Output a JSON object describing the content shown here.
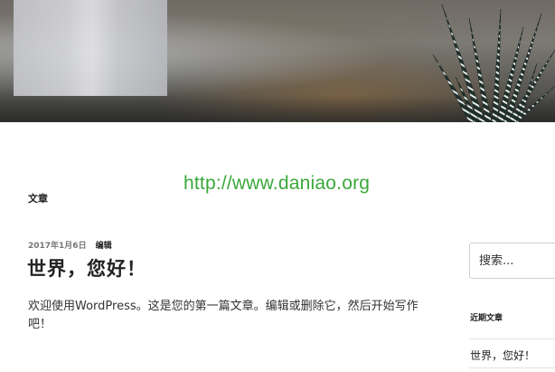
{
  "header": {
    "image_description_icon": "plant-header-image"
  },
  "watermark": {
    "text": "http://www.daniao.org"
  },
  "main": {
    "section_heading": "文章",
    "post": {
      "date": "2017年1月6日",
      "edit_label": "编辑",
      "title": "世界，您好！",
      "excerpt": "欢迎使用WordPress。这是您的第一篇文章。编辑或删除它，然后开始写作吧！"
    }
  },
  "sidebar": {
    "search": {
      "placeholder": "搜索..."
    },
    "recent_posts": {
      "title": "近期文章",
      "items": [
        {
          "label": "世界，您好！"
        }
      ]
    }
  },
  "colors": {
    "watermark": "#3aa83a",
    "meta_text": "#767676",
    "text": "#222222"
  }
}
